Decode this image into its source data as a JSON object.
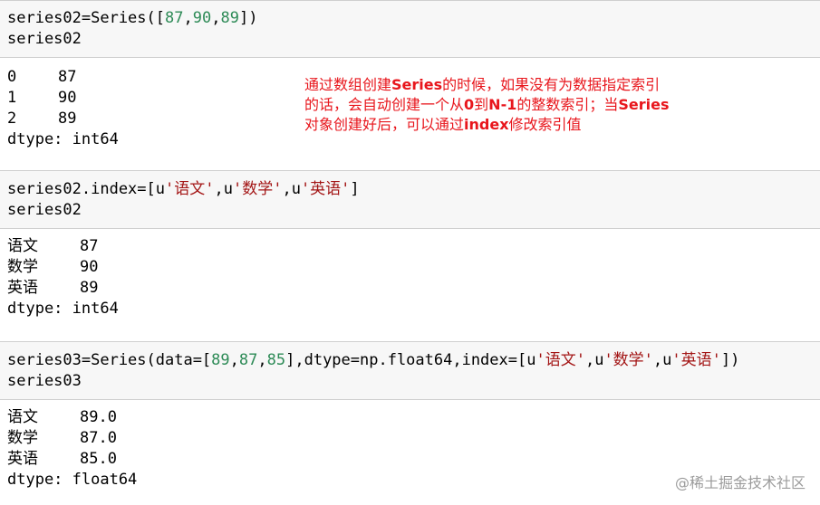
{
  "cells": [
    {
      "input": {
        "line1_prefix": "series02=Series([",
        "line1_n1": "87",
        "line1_sep1": ",",
        "line1_n2": "90",
        "line1_sep2": ",",
        "line1_n3": "89",
        "line1_suffix": "])",
        "line2": "series02"
      },
      "output": {
        "rows": [
          {
            "index": "0",
            "value": "87"
          },
          {
            "index": "1",
            "value": "90"
          },
          {
            "index": "2",
            "value": "89"
          }
        ],
        "dtype": "dtype: int64"
      }
    },
    {
      "input": {
        "line1_prefix": "series02.index=[u",
        "line1_s1": "'语文'",
        "line1_mid1": ",u",
        "line1_s2": "'数学'",
        "line1_mid2": ",u",
        "line1_s3": "'英语'",
        "line1_suffix": "]",
        "line2": "series02"
      },
      "output": {
        "rows": [
          {
            "index": "语文",
            "value": "87"
          },
          {
            "index": "数学",
            "value": "90"
          },
          {
            "index": "英语",
            "value": "89"
          }
        ],
        "dtype": "dtype: int64"
      }
    },
    {
      "input": {
        "line1_prefix": "series03=Series(data=[",
        "line1_n1": "89",
        "line1_sep1": ",",
        "line1_n2": "87",
        "line1_sep2": ",",
        "line1_n3": "85",
        "line1_mid": "],dtype=np.float64,index=[u",
        "line1_s1": "'语文'",
        "line1_c1": ",u",
        "line1_s2": "'数学'",
        "line1_c2": ",u",
        "line1_s3": "'英语'",
        "line1_suffix": "])",
        "line2": "series03"
      },
      "output": {
        "rows": [
          {
            "index": "语文",
            "value": "89.0"
          },
          {
            "index": "数学",
            "value": "87.0"
          },
          {
            "index": "英语",
            "value": "85.0"
          }
        ],
        "dtype": "dtype: float64"
      }
    }
  ],
  "annotation": {
    "line1_a": "通过数组创建",
    "line1_b": "Series",
    "line1_c": "的时候，如果没有为数据指定索引",
    "line2_a": "的话，会自动创建一个从",
    "line2_b": "0",
    "line2_c": "到",
    "line2_d": "N-1",
    "line2_e": "的整数索引；当",
    "line2_f": "Series",
    "line3_a": "对象创建好后，可以通过",
    "line3_b": "index",
    "line3_c": "修改索引值"
  },
  "watermark": "@稀土掘金技术社区",
  "colors": {
    "annotation": "#e8161c",
    "number": "#2e8b57",
    "string": "#a31515",
    "input_bg": "#f7f7f7"
  }
}
